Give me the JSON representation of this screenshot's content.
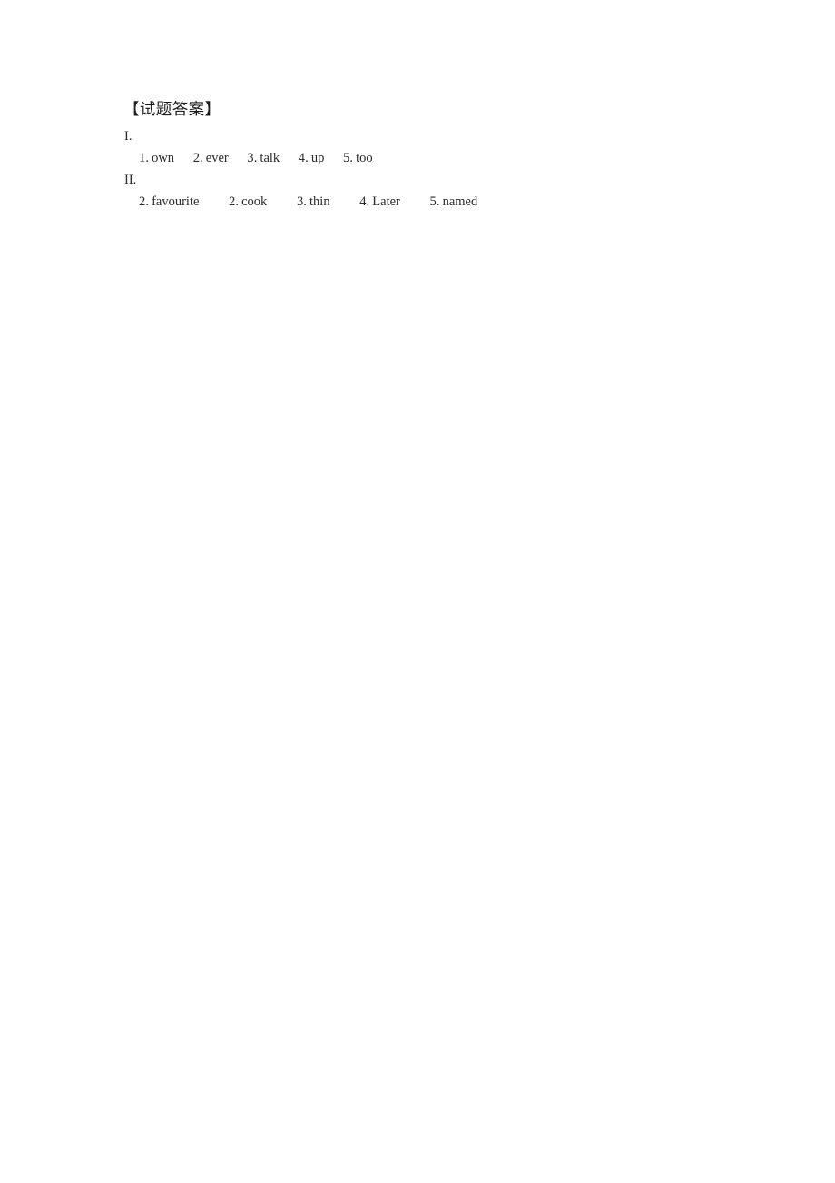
{
  "document": {
    "title": "【试题答案】",
    "sections": [
      {
        "label": "I.",
        "answers": [
          {
            "num": "1.",
            "word": "own"
          },
          {
            "num": "2.",
            "word": "ever"
          },
          {
            "num": "3.",
            "word": "talk"
          },
          {
            "num": "4.",
            "word": "up"
          },
          {
            "num": "5.",
            "word": "too"
          }
        ]
      },
      {
        "label": "II.",
        "answers": [
          {
            "num": "2.",
            "word": "favourite"
          },
          {
            "num": "2.",
            "word": "cook"
          },
          {
            "num": "3.",
            "word": "thin"
          },
          {
            "num": "4.",
            "word": "Later"
          },
          {
            "num": "5.",
            "word": "named"
          }
        ]
      }
    ]
  },
  "colors": {
    "page_background": "#ffffff",
    "text": "#2b2b2b",
    "title_text": "#1d1d1d"
  }
}
